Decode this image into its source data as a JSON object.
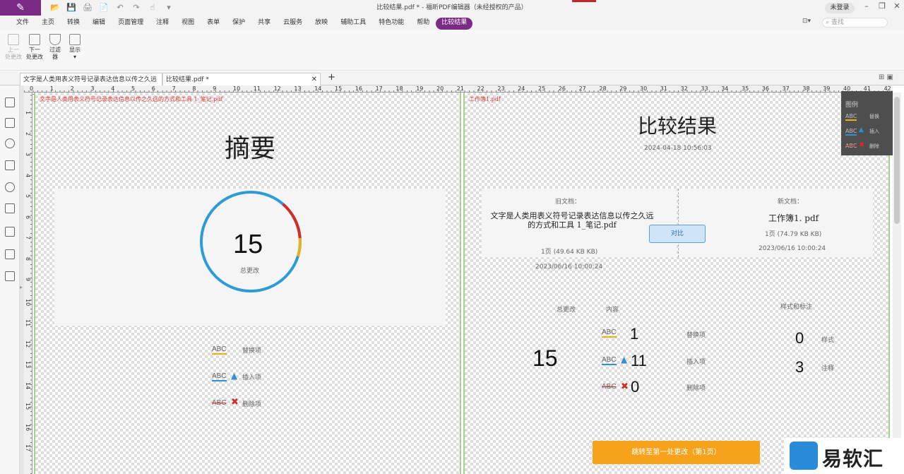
{
  "app": {
    "title": "比较结果.pdf * - 福昕PDF编辑器（未经授权的产品）",
    "login": "未登录",
    "logo": "✎"
  },
  "quick_access": [
    "📂",
    "💾",
    "🖨",
    "📄",
    "↶",
    "↷",
    "☝",
    "▾"
  ],
  "menu": [
    "文件",
    "主页",
    "转换",
    "编辑",
    "页面管理",
    "注释",
    "视图",
    "表单",
    "保护",
    "共享",
    "云服务",
    "放映",
    "辅助工具",
    "特色功能",
    "帮助",
    "比较结果"
  ],
  "menu_active_index": 15,
  "search_placeholder": "查找",
  "ribbon": {
    "prev": "上一\n处更改",
    "next": "下一\n处更改",
    "filter": "过滤\n器",
    "display": "显示"
  },
  "tabs": [
    {
      "label": "文字是人类用表义符号记录表达信息以传之久远的方..."
    },
    {
      "label": "比较结果.pdf *"
    }
  ],
  "ruler_top": [
    "0",
    "1",
    "2",
    "3",
    "4",
    "5",
    "6",
    "7",
    "8",
    "9",
    "10",
    "11",
    "12",
    "13",
    "14",
    "15",
    "16",
    "17",
    "18",
    "19",
    "20",
    "21",
    "22",
    "23",
    "24",
    "25",
    "26",
    "27",
    "28",
    "29",
    "30",
    "31",
    "32",
    "33",
    "34",
    "35",
    "36",
    "37",
    "38",
    "39",
    "40",
    "41",
    "42"
  ],
  "ruler_left": [
    "1",
    "2",
    "3",
    "4",
    "5",
    "6",
    "7",
    "8",
    "9",
    "10",
    "11",
    "12",
    "13",
    "14",
    "15",
    "16",
    "17"
  ],
  "left_page": {
    "file_name": "文字是人类用表义符号记录表达信息以传之久远的方式和工具 1_笔记.pdf",
    "heading": "摘要",
    "total_count": "15",
    "total_label": "总更改",
    "legend": [
      {
        "abc": "ABC",
        "label": "替换项",
        "color": "#e8b21b"
      },
      {
        "abc": "ABC",
        "label": "插入项",
        "color": "#2d8fd6"
      },
      {
        "abc": "ABC",
        "label": "删除项",
        "color": "#d42b2b"
      }
    ]
  },
  "right_page": {
    "file_name": "工作簿1.pdf",
    "heading": "比较结果",
    "date": "2024-04-18 10:56:03",
    "old_doc_label": "旧文档：",
    "old_doc_name": "文字是人类用表义符号记录表达信息以传之久远的方式和工具 1_笔记.pdf",
    "old_doc_info": "1页 (49.64 KB KB)",
    "old_doc_date": "2023/06/16 10:00:24",
    "new_doc_label": "新文档：",
    "new_doc_name": "工作簿1. pdf",
    "new_doc_info": "1页 (74.79 KB KB)",
    "new_doc_date": "2023/06/16 10:00:24",
    "compare_button": "对比",
    "total_label": "总更改",
    "content_label": "内容",
    "style_label": "样式和标注",
    "total_count": "15",
    "replaced": {
      "abc": "ABC",
      "count": "1",
      "label": "替换项"
    },
    "inserted": {
      "abc": "ABC",
      "count": "11",
      "label": "插入项"
    },
    "deleted": {
      "abc": "ABC",
      "count": "0",
      "label": "删除项"
    },
    "style_count": "0",
    "style_text": "样式",
    "annot_count": "3",
    "annot_text": "注释",
    "jump_button": "跳转至第一处更改（第1页）"
  },
  "legend_panel": {
    "title": "图例",
    "items": [
      {
        "abc": "ABC",
        "label": "替换"
      },
      {
        "abc": "ABC",
        "label": "插入"
      },
      {
        "abc": "ABC",
        "label": "删除"
      }
    ]
  },
  "watermark": {
    "text": "易软汇"
  },
  "colors": {
    "brand": "#7b2a86",
    "replace": "#e8b21b",
    "insert": "#2d8fd6",
    "delete": "#d42b2b",
    "ring": "#2d9bd6",
    "jump": "#f7a21b"
  }
}
